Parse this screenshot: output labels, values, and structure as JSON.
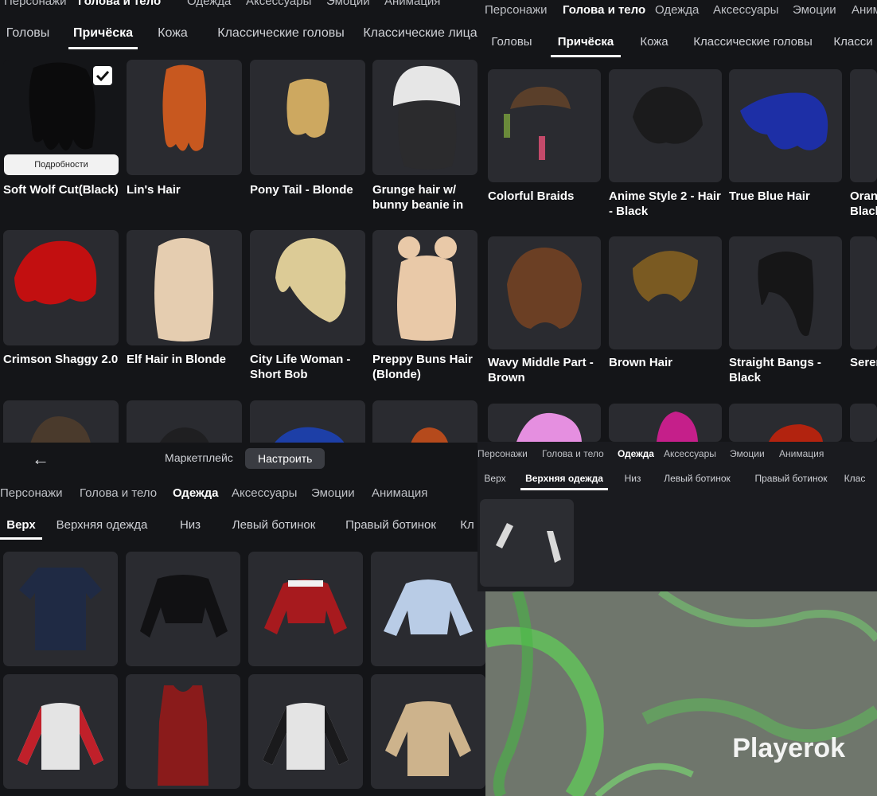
{
  "panelA": {
    "nav": [
      "Персонажи",
      "Голова и тело",
      "Одежда",
      "Аксессуары",
      "Эмоции",
      "Анимация"
    ],
    "tabs": [
      "Головы",
      "Причёска",
      "Кожа",
      "Классические головы",
      "Классические лица"
    ],
    "details_label": "Подробности",
    "items": [
      {
        "name": "Soft Wolf Cut(Black)"
      },
      {
        "name": "Lin's Hair"
      },
      {
        "name": "Pony Tail - Blonde"
      },
      {
        "name": "Grunge hair w/ bunny beanie in"
      },
      {
        "name": "Crimson Shaggy 2.0"
      },
      {
        "name": "Elf Hair in Blonde"
      },
      {
        "name": "City Life Woman - Short Bob"
      },
      {
        "name": "Preppy Buns Hair (Blonde)"
      }
    ]
  },
  "panelB": {
    "nav": [
      "Персонажи",
      "Голова и тело",
      "Одежда",
      "Аксессуары",
      "Эмоции",
      "Аним"
    ],
    "tabs": [
      "Головы",
      "Причёска",
      "Кожа",
      "Классические головы",
      "Класси"
    ],
    "items": [
      {
        "name": "Colorful Braids"
      },
      {
        "name": "Anime Style 2 - Hair - Black"
      },
      {
        "name": "True Blue Hair"
      },
      {
        "name": "Oran Black"
      },
      {
        "name": "Wavy Middle Part - Brown"
      },
      {
        "name": "Brown Hair"
      },
      {
        "name": "Straight Bangs - Black"
      },
      {
        "name": "Seren"
      }
    ]
  },
  "panelC": {
    "bottombar": {
      "market": "Маркетплейс",
      "setup": "Настроить"
    },
    "nav": [
      "Персонажи",
      "Голова и тело",
      "Одежда",
      "Аксессуары",
      "Эмоции",
      "Анимация"
    ],
    "tabs": [
      "Верх",
      "Верхняя одежда",
      "Низ",
      "Левый ботинок",
      "Правый ботинок",
      "Кл"
    ]
  },
  "panelD": {
    "nav": [
      "Персонажи",
      "Голова и тело",
      "Одежда",
      "Аксессуары",
      "Эмоции",
      "Анимация"
    ],
    "tabs": [
      "Верх",
      "Верхняя одежда",
      "Низ",
      "Левый ботинок",
      "Правый ботинок",
      "Клас"
    ]
  },
  "watermark": "Playerok",
  "colors": {
    "background": "#141518",
    "tile": "#2a2b30",
    "active_underline": "#ffffff",
    "aurora": "#6a7268"
  }
}
